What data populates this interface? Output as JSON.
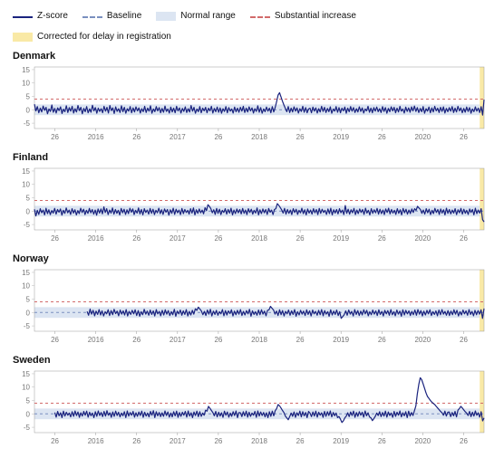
{
  "legend": {
    "zscore": "Z-score",
    "baseline": "Baseline",
    "normal": "Normal range",
    "substantial": "Substantial increase",
    "corrected": "Corrected for delay in registration"
  },
  "y_ticks": [
    -5,
    0,
    5,
    10,
    15
  ],
  "x_labels_per_year_one": [
    "26",
    "2016",
    "26",
    "2017",
    "26",
    "2018",
    "26",
    "2019",
    "26",
    "2020",
    "26"
  ],
  "baseline_value": 0,
  "normal_range": [
    -2,
    2
  ],
  "substantial_value": 4,
  "chart_data": [
    {
      "title": "Denmark",
      "type": "line",
      "ylim": [
        -7,
        16
      ],
      "values": [
        2.1,
        -0.4,
        1.2,
        -1.1,
        0.6,
        -0.8,
        1.4,
        -0.2,
        0.9,
        -1.5,
        0.3,
        -0.6,
        1.8,
        -0.9,
        0.5,
        -1.2,
        0.7,
        -0.3,
        1.1,
        -1.4,
        0.2,
        -0.7,
        1.5,
        -1.0,
        0.8,
        -0.5,
        1.3,
        -1.2,
        0.4,
        -0.8,
        1.6,
        -0.3,
        0.9,
        -1.5,
        0.5,
        -0.7,
        1.2,
        -1.1,
        0.3,
        -0.9,
        1.7,
        -0.4,
        0.8,
        -1.3,
        0.6,
        -0.6,
        0.4,
        -1.1,
        1.3,
        -0.5,
        0.9,
        -1.2,
        1.6,
        -0.3,
        0.7,
        -1.4,
        1.1,
        -0.6,
        0.4,
        -1.0,
        1.5,
        -0.7,
        0.9,
        -1.3,
        0.4,
        -0.5,
        1.2,
        -1.1,
        0.7,
        -0.8,
        1.1,
        -0.4,
        0.7,
        -1.2,
        0.4,
        -0.7,
        1.3,
        -1.0,
        0.6,
        -0.5,
        1.5,
        -1.3,
        0.3,
        -0.7,
        1.2,
        -0.4,
        0.8,
        -1.1,
        0.5,
        -0.9,
        1.4,
        -0.6,
        0.3,
        -1.2,
        1.0,
        -0.8,
        0.6,
        -1.1,
        1.3,
        -0.4,
        0.7,
        -1.2,
        0.5,
        -0.6,
        1.1,
        -1.0,
        0.4,
        -0.8,
        1.6,
        -0.5,
        0.9,
        -1.3,
        0.3,
        -0.7,
        1.2,
        -1.1,
        0.6,
        -0.4,
        0.9,
        -1.1,
        0.6,
        -0.4,
        1.3,
        -1.2,
        0.5,
        -0.7,
        1.0,
        -0.9,
        0.7,
        -1.3,
        0.4,
        -0.6,
        1.2,
        -1.1,
        0.8,
        -0.5,
        0.3,
        -1.2,
        1.0,
        -0.7,
        0.6,
        -0.9,
        0.9,
        -0.5,
        1.3,
        -1.0,
        0.6,
        -0.8,
        1.1,
        -0.4,
        0.7,
        -1.2,
        0.4,
        -0.6,
        1.5,
        -0.9,
        0.8,
        -1.3,
        0.3,
        -0.7,
        1.0,
        -0.5,
        0.6,
        -1.1,
        1.2,
        -0.8,
        0.9,
        3.1,
        5.5,
        6.4,
        4.8,
        3.2,
        1.8,
        0.5,
        -0.7,
        1.2,
        -1.0,
        0.6,
        -0.8,
        1.1,
        -0.5,
        0.7,
        -1.2,
        0.4,
        -0.6,
        1.3,
        -0.9,
        0.8,
        -1.1,
        0.3,
        0.6,
        -1.1,
        1.0,
        -0.5,
        0.7,
        -1.2,
        0.4,
        -0.8,
        1.3,
        -0.6,
        0.9,
        -1.0,
        0.5,
        -0.7,
        1.1,
        -1.3,
        0.3,
        -0.5,
        1.2,
        -0.9,
        0.8,
        -1.1,
        0.6,
        -0.4,
        1.0,
        -1.3,
        0.6,
        -0.7,
        1.2,
        -0.5,
        0.8,
        -1.0,
        0.4,
        -0.8,
        1.1,
        -0.6,
        0.7,
        -1.2,
        0.3,
        -0.4,
        1.3,
        -0.9,
        0.6,
        -1.1,
        0.8,
        -0.5,
        1.0,
        -0.7,
        0.4,
        -1.0,
        1.2,
        -0.6,
        0.8,
        -1.3,
        0.5,
        -0.7,
        1.1,
        -0.4,
        0.9,
        -1.1,
        0.6,
        -0.8,
        1.3,
        -0.5,
        0.3,
        -1.2,
        1.0,
        -0.6,
        0.7,
        -0.9,
        1.1,
        -0.4,
        1.4,
        -0.6,
        0.8,
        -1.0,
        0.5,
        -0.7,
        1.2,
        -1.3,
        0.4,
        -0.5,
        1.0,
        -1.1,
        0.7,
        -0.8,
        1.3,
        -0.4,
        0.6,
        -1.0,
        0.9,
        -0.6,
        1.1,
        -1.2,
        0.5,
        -0.7,
        0.8,
        -0.5,
        1.2,
        -1.0,
        0.6,
        -0.8,
        1.3,
        -0.4,
        0.7,
        -1.1,
        0.5,
        -0.9,
        1.0,
        -0.6,
        0.8,
        -1.3,
        0.3,
        -0.7,
        1.1,
        -0.5,
        0.6,
        -1.0,
        1.2,
        -2.0,
        3.8
      ],
      "corrected_last_n": 4
    },
    {
      "title": "Finland",
      "type": "line",
      "ylim": [
        -7,
        16
      ],
      "values": [
        0.7,
        -1.8,
        0.3,
        -1.2,
        0.9,
        -0.6,
        0.4,
        -1.4,
        1.1,
        -0.9,
        0.5,
        -1.3,
        0.2,
        -0.7,
        1.0,
        -1.1,
        0.6,
        -0.4,
        0.8,
        -1.5,
        0.3,
        -0.8,
        1.2,
        -0.6,
        0.4,
        -1.2,
        0.9,
        -0.7,
        0.5,
        -1.4,
        0.2,
        -0.9,
        1.1,
        -0.5,
        0.7,
        -1.3,
        0.3,
        -0.8,
        1.0,
        -0.6,
        0.6,
        -1.1,
        0.4,
        -1.5,
        0.8,
        -0.7,
        0.8,
        -1.0,
        1.6,
        -0.5,
        0.9,
        -1.3,
        0.4,
        -0.7,
        1.2,
        -1.1,
        0.6,
        -0.8,
        0.3,
        -1.4,
        1.0,
        -0.6,
        0.7,
        -1.2,
        0.5,
        -0.9,
        1.1,
        -0.4,
        0.8,
        -1.3,
        0.3,
        -0.7,
        1.2,
        -1.0,
        0.6,
        -1.4,
        0.9,
        -0.5,
        0.4,
        -1.1,
        1.0,
        -0.8,
        0.7,
        -1.3,
        0.3,
        -0.6,
        1.1,
        -0.9,
        0.5,
        -1.2,
        0.8,
        -0.4,
        0.6,
        -1.5,
        0.5,
        -0.8,
        1.1,
        -1.2,
        0.7,
        -0.6,
        0.4,
        -1.3,
        1.0,
        -0.9,
        0.6,
        -0.5,
        0.3,
        -1.1,
        0.9,
        -0.7,
        1.2,
        -1.4,
        0.5,
        -0.8,
        0.8,
        -0.6,
        0.4,
        -1.0,
        1.3,
        0.2,
        2.4,
        1.8,
        0.9,
        -0.6,
        0.5,
        -1.2,
        1.0,
        -0.8,
        0.7,
        -1.3,
        0.3,
        -0.5,
        0.9,
        -1.1,
        0.6,
        -0.7,
        1.1,
        -1.4,
        0.4,
        -0.9,
        0.8,
        -0.6,
        0.6,
        -1.0,
        1.0,
        -0.8,
        0.4,
        -1.3,
        0.9,
        -0.5,
        0.7,
        -1.1,
        0.3,
        -0.7,
        1.2,
        -1.4,
        0.5,
        -0.9,
        0.8,
        -0.6,
        0.6,
        -1.2,
        1.0,
        -0.4,
        0.4,
        -1.3,
        0.6,
        0.9,
        2.8,
        2.2,
        1.4,
        0.5,
        -0.7,
        1.0,
        -1.1,
        0.6,
        -0.8,
        0.4,
        -1.3,
        0.9,
        -0.5,
        0.7,
        -1.2,
        0.3,
        -0.6,
        1.1,
        -0.9,
        0.5,
        -1.4,
        0.8,
        -0.7,
        0.4,
        -1.1,
        0.9,
        -0.6,
        0.6,
        -1.3,
        1.0,
        -0.8,
        0.7,
        -0.5,
        0.3,
        -1.2,
        0.8,
        -0.9,
        1.1,
        -1.4,
        0.5,
        -0.7,
        0.6,
        -1.0,
        0.9,
        -0.6,
        0.4,
        -1.3,
        2.1,
        -0.8,
        0.7,
        -1.1,
        0.5,
        -0.6,
        1.0,
        -1.3,
        0.4,
        -0.9,
        0.8,
        -0.5,
        0.6,
        -1.2,
        1.1,
        -0.7,
        0.3,
        -1.4,
        0.9,
        -0.8,
        0.5,
        -0.6,
        1.0,
        -1.1,
        0.7,
        -0.9,
        0.4,
        -1.3,
        0.8,
        -0.5,
        1.1,
        -1.0,
        0.6,
        -0.7,
        0.3,
        -1.2,
        0.9,
        -0.8,
        0.5,
        -1.4,
        1.0,
        -0.6,
        0.7,
        -1.1,
        0.4,
        -0.9,
        0.8,
        -0.5,
        0.9,
        0.3,
        1.8,
        1.2,
        0.6,
        -0.8,
        0.4,
        -1.1,
        0.9,
        -0.6,
        0.7,
        -1.3,
        0.3,
        -0.9,
        1.0,
        -0.5,
        0.6,
        -1.2,
        0.8,
        -0.7,
        0.5,
        -1.4,
        1.1,
        -0.8,
        0.6,
        -1.0,
        0.4,
        -0.7,
        0.9,
        -1.3,
        0.5,
        -0.6,
        1.0,
        -1.1,
        0.7,
        -0.8,
        0.3,
        -1.2,
        0.8,
        -0.5,
        0.6,
        -1.4,
        1.1,
        -0.9,
        0.4,
        -0.7,
        0.9,
        -3.2,
        -4.0
      ],
      "corrected_last_n": 4
    },
    {
      "title": "Norway",
      "type": "line",
      "ylim": [
        -7,
        16
      ],
      "values": [
        null,
        null,
        null,
        null,
        null,
        null,
        null,
        null,
        null,
        null,
        null,
        null,
        null,
        null,
        null,
        null,
        null,
        null,
        null,
        null,
        null,
        null,
        null,
        null,
        null,
        null,
        null,
        null,
        null,
        null,
        null,
        null,
        null,
        null,
        null,
        0.4,
        -1.0,
        1.3,
        -0.6,
        0.8,
        -1.2,
        0.5,
        -0.7,
        1.1,
        -0.9,
        0.6,
        -1.3,
        0.3,
        -0.5,
        1.0,
        -1.1,
        0.7,
        -0.8,
        1.2,
        -0.4,
        0.5,
        -1.2,
        0.9,
        -0.6,
        0.6,
        -0.9,
        1.1,
        -1.3,
        0.4,
        -0.7,
        0.8,
        -0.5,
        1.0,
        -1.1,
        0.7,
        -1.4,
        0.3,
        -0.8,
        1.2,
        -0.6,
        0.5,
        -1.0,
        0.9,
        -0.7,
        0.6,
        -1.3,
        1.1,
        -0.5,
        0.4,
        -1.2,
        0.8,
        -0.9,
        1.0,
        -0.6,
        0.7,
        -1.1,
        0.3,
        -0.8,
        1.2,
        -1.4,
        0.5,
        -0.5,
        0.9,
        -1.0,
        0.6,
        -0.7,
        1.1,
        -1.3,
        0.4,
        -0.9,
        0.8,
        -0.6,
        1.4,
        0.8,
        2.0,
        1.3,
        0.6,
        -0.8,
        0.4,
        -1.1,
        0.9,
        -0.6,
        1.2,
        -1.3,
        0.5,
        -0.7,
        0.8,
        -1.0,
        0.3,
        -0.5,
        1.1,
        -1.2,
        0.7,
        -0.9,
        0.6,
        -0.4,
        1.0,
        -1.3,
        0.5,
        -0.8,
        0.8,
        -0.6,
        1.1,
        -1.1,
        0.4,
        -0.9,
        0.7,
        -0.5,
        1.2,
        -1.4,
        0.6,
        -0.7,
        0.3,
        -1.0,
        0.9,
        -0.8,
        1.0,
        -0.6,
        0.5,
        -1.2,
        0.8,
        1.0,
        2.3,
        1.6,
        0.9,
        -0.6,
        0.5,
        -1.1,
        1.0,
        -0.8,
        0.7,
        -1.3,
        0.4,
        -0.5,
        0.9,
        -1.0,
        0.6,
        -0.7,
        1.1,
        -1.4,
        0.3,
        -0.9,
        0.8,
        -0.6,
        0.5,
        -1.1,
        1.0,
        -0.7,
        0.6,
        -1.3,
        0.9,
        -0.5,
        0.4,
        -1.0,
        0.8,
        -0.8,
        1.1,
        -1.2,
        0.7,
        -0.6,
        0.3,
        -1.4,
        1.0,
        -0.9,
        0.5,
        -0.7,
        0.9,
        -1.1,
        0.3,
        -2.2,
        -1.5,
        -0.8,
        0.6,
        -1.0,
        0.9,
        -0.6,
        0.4,
        -1.3,
        1.1,
        -0.7,
        0.7,
        -1.1,
        0.5,
        -0.9,
        1.0,
        -0.5,
        0.8,
        -1.2,
        0.3,
        -0.8,
        0.9,
        -0.6,
        0.6,
        -1.1,
        1.0,
        -0.7,
        0.4,
        -1.3,
        0.8,
        -0.5,
        0.7,
        -1.0,
        1.1,
        -0.8,
        0.3,
        -1.2,
        0.9,
        -0.6,
        0.5,
        -1.4,
        1.0,
        -0.9,
        0.8,
        -0.5,
        0.6,
        -1.1,
        0.4,
        -0.8,
        0.9,
        -1.0,
        1.1,
        -0.6,
        0.7,
        -1.3,
        0.5,
        -0.9,
        0.8,
        -0.5,
        1.0,
        -1.1,
        0.3,
        -0.7,
        0.6,
        -1.2,
        0.9,
        -0.8,
        1.1,
        -0.6,
        0.4,
        -1.0,
        0.7,
        -1.1,
        0.5,
        -0.8,
        1.0,
        -0.6,
        0.8,
        -1.3,
        0.3,
        -0.9,
        0.9,
        -0.5,
        0.6,
        -1.0,
        1.1,
        -0.7,
        0.4,
        -1.2,
        0.8,
        -0.8,
        0.7,
        -0.6,
        1.0,
        -2.2,
        1.5
      ],
      "corrected_last_n": 4
    },
    {
      "title": "Sweden",
      "type": "line",
      "ylim": [
        -7,
        16
      ],
      "values": [
        null,
        null,
        null,
        null,
        null,
        null,
        null,
        null,
        null,
        null,
        null,
        null,
        null,
        null,
        0.5,
        -1.2,
        0.9,
        -0.7,
        0.4,
        -1.4,
        1.0,
        -0.8,
        0.6,
        -0.5,
        0.3,
        -1.1,
        0.8,
        -0.9,
        1.1,
        -0.6,
        0.7,
        -1.3,
        0.4,
        -0.8,
        0.9,
        -0.5,
        1.0,
        -1.2,
        0.6,
        -0.7,
        0.3,
        -1.4,
        0.8,
        -0.9,
        1.1,
        -0.6,
        0.5,
        -1.0,
        0.9,
        -0.8,
        1.2,
        -0.5,
        0.4,
        -1.3,
        0.7,
        -0.9,
        1.0,
        -0.6,
        0.6,
        -1.1,
        0.3,
        -0.7,
        0.8,
        -1.4,
        1.1,
        -0.8,
        0.5,
        -0.5,
        0.9,
        -1.2,
        0.4,
        -0.9,
        0.7,
        -0.6,
        1.0,
        -1.3,
        0.6,
        -0.8,
        0.3,
        -1.1,
        0.9,
        -0.5,
        1.2,
        -1.4,
        0.8,
        -0.7,
        0.5,
        -1.0,
        0.4,
        -0.9,
        1.1,
        -0.6,
        0.7,
        -1.2,
        0.3,
        -1.1,
        0.8,
        -0.7,
        1.0,
        -1.3,
        0.5,
        -0.9,
        0.6,
        -0.5,
        0.9,
        -1.2,
        1.1,
        -0.8,
        0.4,
        -1.4,
        0.7,
        -0.6,
        1.0,
        -1.0,
        0.8,
        -0.9,
        0.3,
        -0.5,
        1.4,
        1.0,
        2.8,
        2.1,
        1.3,
        0.5,
        -0.7,
        0.9,
        -1.1,
        0.6,
        -0.8,
        0.4,
        -1.3,
        1.0,
        -0.5,
        0.7,
        -1.2,
        0.3,
        -0.9,
        0.8,
        -0.6,
        1.1,
        -1.4,
        0.5,
        0.4,
        -1.0,
        0.8,
        -0.7,
        1.0,
        -1.2,
        0.6,
        -0.9,
        0.3,
        -0.5,
        0.9,
        -1.3,
        1.1,
        -0.8,
        0.7,
        -0.6,
        0.5,
        -1.1,
        0.4,
        -1.4,
        0.8,
        -0.9,
        1.0,
        -0.7,
        1.2,
        2.0,
        3.5,
        3.0,
        2.2,
        1.3,
        0.5,
        -0.8,
        -1.5,
        -2.2,
        -1.0,
        0.3,
        -0.9,
        0.7,
        -1.3,
        0.4,
        -0.6,
        1.0,
        -1.1,
        0.8,
        -0.7,
        0.5,
        -1.4,
        0.9,
        0.3,
        -1.0,
        0.7,
        -0.8,
        1.0,
        -1.2,
        0.6,
        -0.5,
        0.4,
        -1.3,
        0.9,
        -0.9,
        0.8,
        -0.6,
        1.1,
        -1.1,
        0.5,
        -0.7,
        0.3,
        -1.4,
        -1.0,
        -2.0,
        -3.2,
        -2.6,
        -1.5,
        -0.8,
        0.4,
        -1.0,
        0.7,
        -0.6,
        1.0,
        -1.3,
        0.5,
        -0.9,
        0.8,
        -0.5,
        0.6,
        -1.2,
        1.1,
        -0.7,
        0.4,
        -1.1,
        -1.5,
        -2.5,
        -1.8,
        -0.9,
        0.3,
        -0.6,
        0.8,
        -1.0,
        0.5,
        -0.8,
        1.0,
        -1.2,
        0.7,
        -0.6,
        0.3,
        -1.3,
        0.9,
        -0.9,
        0.6,
        -0.5,
        1.1,
        -1.1,
        0.4,
        -0.7,
        0.8,
        -1.4,
        1.0,
        -0.8,
        0.5,
        -0.6,
        1.2,
        3.0,
        7.5,
        11.0,
        13.5,
        12.8,
        11.2,
        9.5,
        7.8,
        6.5,
        5.8,
        5.0,
        4.4,
        3.9,
        3.5,
        2.8,
        2.2,
        1.6,
        0.9,
        0.4,
        -0.5,
        1.0,
        -0.8,
        0.6,
        0.7,
        -1.0,
        0.5,
        -0.7,
        0.9,
        -1.1,
        1.4,
        2.0,
        2.8,
        2.2,
        1.5,
        0.8,
        0.3,
        -0.6,
        0.9,
        -1.0,
        0.6,
        -0.8,
        1.1,
        -0.5,
        0.4,
        -1.2,
        0.8,
        -2.6,
        -1.5
      ],
      "corrected_last_n": 4
    }
  ]
}
